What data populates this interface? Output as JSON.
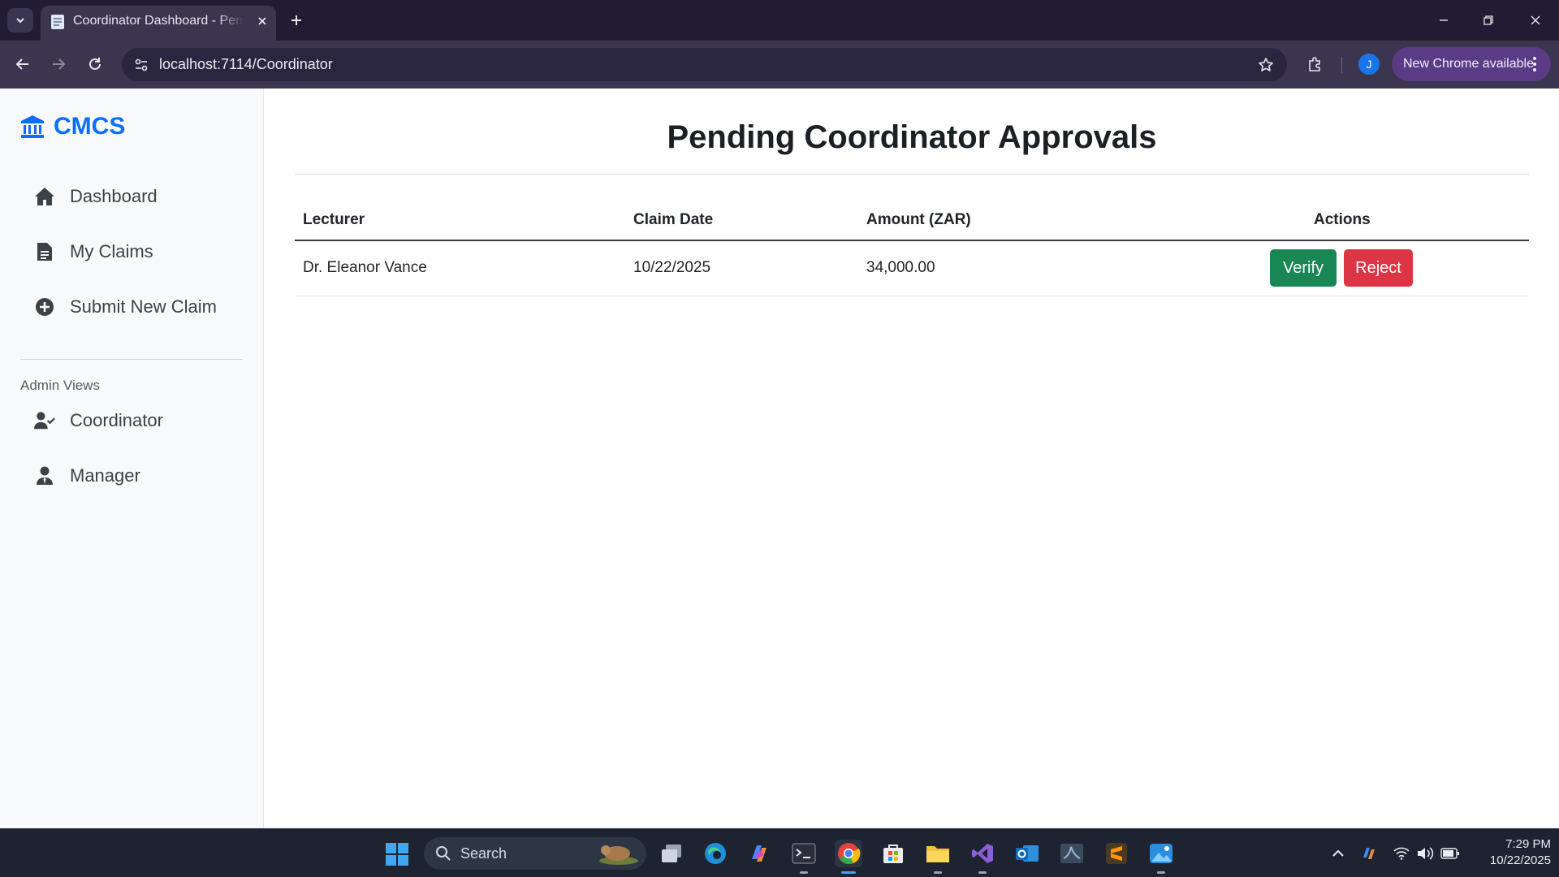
{
  "browser": {
    "tab_title": "Coordinator Dashboard - Pending Approvals",
    "url": "localhost:7114/Coordinator",
    "profile_initial": "J",
    "update_label": "New Chrome available"
  },
  "sidebar": {
    "brand": "CMCS",
    "items": [
      {
        "label": "Dashboard",
        "icon": "home-icon"
      },
      {
        "label": "My Claims",
        "icon": "document-icon"
      },
      {
        "label": "Submit New Claim",
        "icon": "plus-circle-icon"
      }
    ],
    "admin_heading": "Admin Views",
    "admin_items": [
      {
        "label": "Coordinator",
        "icon": "user-check-icon"
      },
      {
        "label": "Manager",
        "icon": "user-tie-icon"
      }
    ]
  },
  "main": {
    "title": "Pending Coordinator Approvals",
    "columns": [
      "Lecturer",
      "Claim Date",
      "Amount (ZAR)",
      "Actions"
    ],
    "rows": [
      {
        "lecturer": "Dr. Eleanor Vance",
        "claim_date": "10/22/2025",
        "amount": "34,000.00",
        "verify_label": "Verify",
        "reject_label": "Reject"
      }
    ]
  },
  "taskbar": {
    "search_label": "Search",
    "time": "7:29 PM",
    "date": "10/22/2025"
  },
  "colors": {
    "brand": "#0d6efd",
    "verify": "#198754",
    "reject": "#dc3545",
    "chrome_frame": "#211c33",
    "update_pill": "#5b3a86"
  }
}
